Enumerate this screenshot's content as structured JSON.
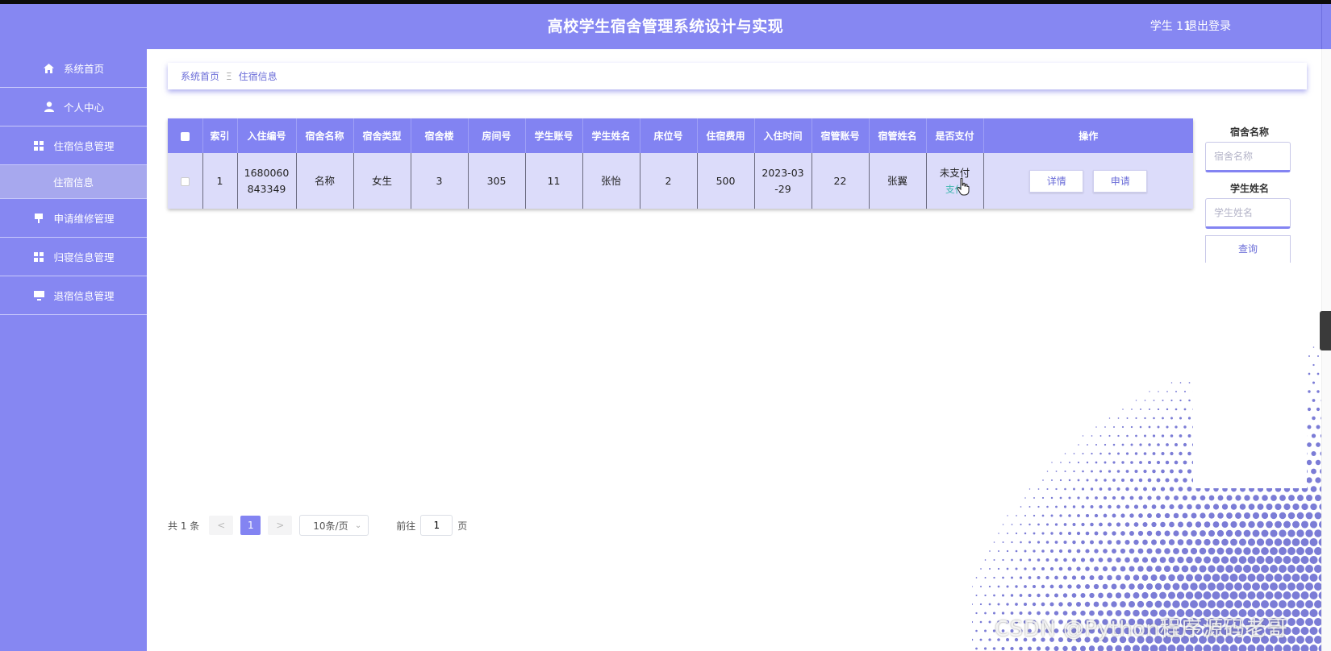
{
  "header": {
    "title": "高校学生宿舍管理系统设计与实现",
    "user": "学生 11",
    "logout": "退出登录"
  },
  "sidebar": {
    "items": [
      {
        "label": "系统首页",
        "icon": "home-icon"
      },
      {
        "label": "个人中心",
        "icon": "user-icon"
      },
      {
        "label": "住宿信息管理",
        "icon": "grid-icon"
      },
      {
        "label": "住宿信息",
        "icon": ""
      },
      {
        "label": "申请维修管理",
        "icon": "monitor-icon"
      },
      {
        "label": "归寝信息管理",
        "icon": "grid-icon"
      },
      {
        "label": "退宿信息管理",
        "icon": "monitor-icon"
      }
    ]
  },
  "breadcrumb": {
    "home": "系统首页",
    "sep": "Ξ",
    "current": "住宿信息"
  },
  "table": {
    "columns": [
      "索引",
      "入住编号",
      "宿舍名称",
      "宿舍类型",
      "宿舍楼",
      "房间号",
      "学生账号",
      "学生姓名",
      "床位号",
      "住宿费用",
      "入住时间",
      "宿管账号",
      "宿管姓名",
      "是否支付",
      "操作"
    ],
    "rows": [
      {
        "index": "1",
        "checkin_no_a": "1680060",
        "checkin_no_b": "843349",
        "dorm_name": "名称",
        "dorm_type": "女生",
        "building": "3",
        "room": "305",
        "student_account": "11",
        "student_name": "张怡",
        "bed": "2",
        "fee": "500",
        "date_a": "2023-03",
        "date_b": "-29",
        "manager_account": "22",
        "manager_name": "张翼",
        "paid": "未支付",
        "pay_link": "支付",
        "detail_btn": "详情",
        "apply_btn": "申请"
      }
    ]
  },
  "search": {
    "dorm_label": "宿舍名称",
    "dorm_placeholder": "宿舍名称",
    "student_label": "学生姓名",
    "student_placeholder": "学生姓名",
    "query_btn": "查询"
  },
  "pager": {
    "total": "共 1 条",
    "prev": "<",
    "page": "1",
    "next": ">",
    "size": "10条/页",
    "goto_label": "前往",
    "goto_value": "1",
    "page_suffix": "页"
  },
  "watermark": "CSDN @Python程序源码老哥",
  "colors": {
    "accent": "#8687f2",
    "row_bg": "#dcdcfa",
    "pay_link": "#3fb8af"
  }
}
